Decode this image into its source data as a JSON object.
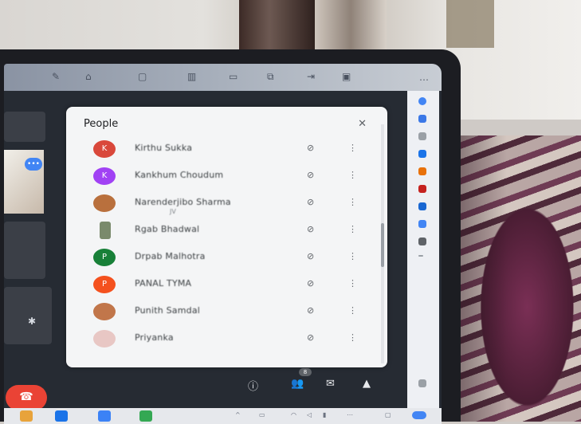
{
  "panel": {
    "title": "People",
    "close_glyph": "✕"
  },
  "participants": [
    {
      "initial": "K",
      "name": "Kirthu Sukka",
      "color": "#d9483b"
    },
    {
      "initial": "K",
      "name": "Kankhum Choudum",
      "color": "#a142f4"
    },
    {
      "initial": "",
      "name": "Narenderjibo Sharma",
      "sub": "JV",
      "color": "#b9703d"
    },
    {
      "initial": "",
      "name": "Rgab Bhadwal",
      "color": "#7a8a6c"
    },
    {
      "initial": "P",
      "name": "Drpab Malhotra",
      "color": "#188038"
    },
    {
      "initial": "P",
      "name": "PANAL TYMA",
      "color": "#f4511e"
    },
    {
      "initial": "",
      "name": "Punith Samdal",
      "color": "#c1764a"
    },
    {
      "initial": "",
      "name": "Priyanka",
      "color": "#e8c7c4"
    }
  ],
  "icons": {
    "mic_off": "mic-off-icon",
    "more": "more-vert-icon",
    "close": "close-icon",
    "info": "info-icon",
    "people": "people-icon",
    "chat": "chat-icon",
    "activities": "activities-icon",
    "end_call": "end-call-icon"
  },
  "controls": {
    "people_count": "8"
  },
  "colors": {
    "end_call": "#ea4335",
    "accent_blue": "#4285f4"
  }
}
